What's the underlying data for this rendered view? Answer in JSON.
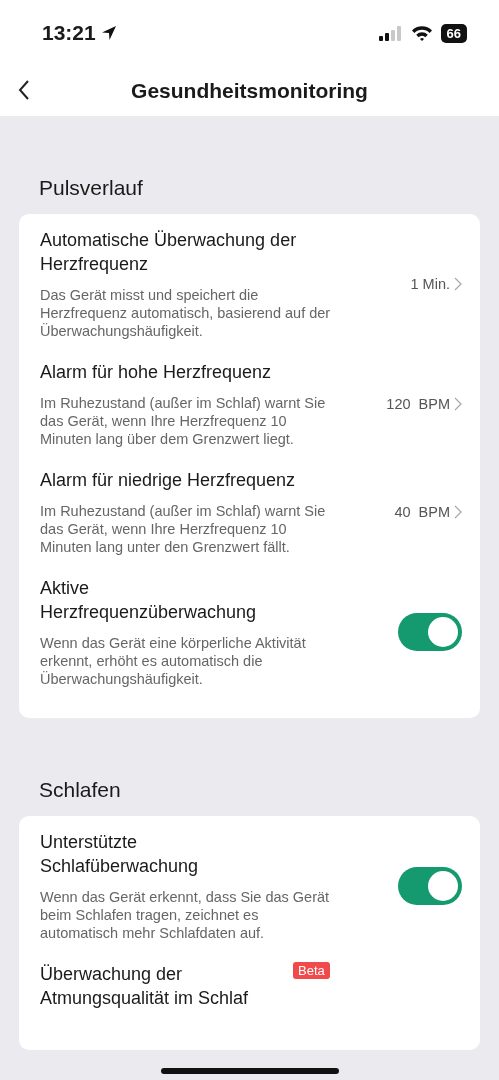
{
  "status_bar": {
    "time": "13:21",
    "battery": "66"
  },
  "nav": {
    "title": "Gesundheitsmonitoring"
  },
  "sections": [
    {
      "title": "Pulsverlauf",
      "items": [
        {
          "kind": "value",
          "title": "Automatische Überwachung der Herzfrequenz",
          "description": "Das Gerät misst und speichert die Herzfrequenz automatisch, basierend auf der Überwachungshäufigkeit.",
          "value": "1 Min."
        },
        {
          "kind": "value",
          "title": "Alarm für hohe Herzfrequenz",
          "description": "Im Ruhezustand (außer im Schlaf) warnt Sie das Gerät, wenn Ihre Herzfrequenz 10 Minuten lang über dem Grenzwert liegt.",
          "value": "120  BPM"
        },
        {
          "kind": "value",
          "title": "Alarm für niedrige Herzfrequenz",
          "description": "Im Ruhezustand (außer im Schlaf) warnt Sie das Gerät, wenn Ihre Herzfrequenz 10 Minuten lang unter den Grenzwert fällt.",
          "value": "40  BPM"
        },
        {
          "kind": "toggle",
          "title": "Aktive Herzfrequenzüberwachung",
          "description": "Wenn das Gerät eine körperliche Aktivität erkennt, erhöht es automatisch die Überwachungshäufigkeit.",
          "on": true
        }
      ]
    },
    {
      "title": "Schlafen",
      "items": [
        {
          "kind": "toggle",
          "title": "Unterstützte Schlafüberwachung",
          "description": "Wenn das Gerät erkennt, dass Sie das Gerät beim Schlafen tragen, zeichnet es automatisch mehr Schlafdaten auf.",
          "on": true
        },
        {
          "kind": "plain",
          "title": "Überwachung der Atmungsqualität im Schlaf",
          "badge": "Beta"
        }
      ]
    }
  ]
}
